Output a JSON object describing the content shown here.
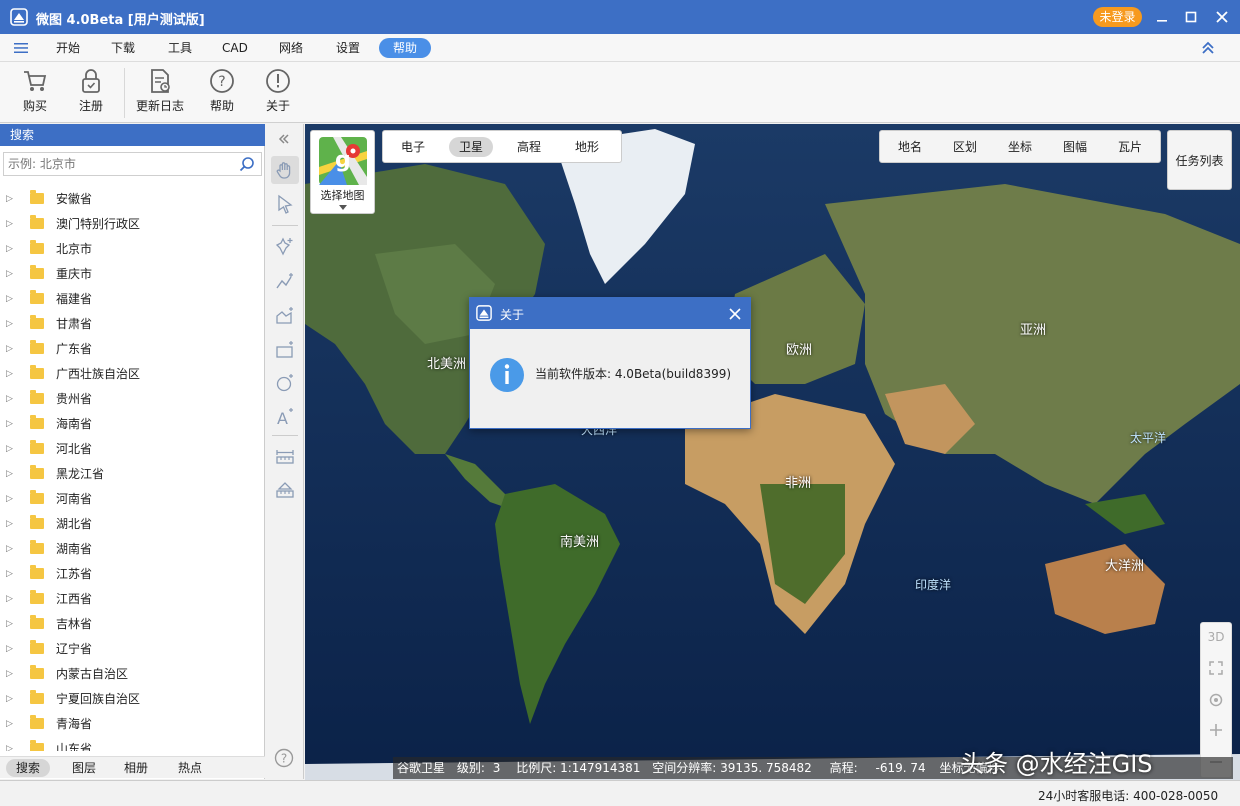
{
  "window": {
    "title": "微图 4.0Beta [用户测试版]",
    "login_label": "未登录"
  },
  "menu": {
    "items": [
      "开始",
      "下载",
      "工具",
      "CAD",
      "网络",
      "设置",
      "帮助"
    ],
    "active": "帮助"
  },
  "ribbon": {
    "buttons": [
      "购买",
      "注册",
      "更新日志",
      "帮助",
      "关于"
    ]
  },
  "left_panel": {
    "header": "搜索",
    "search_placeholder": "示例: 北京市",
    "provinces": [
      "安徽省",
      "澳门特别行政区",
      "北京市",
      "重庆市",
      "福建省",
      "甘肃省",
      "广东省",
      "广西壮族自治区",
      "贵州省",
      "海南省",
      "河北省",
      "黑龙江省",
      "河南省",
      "湖北省",
      "湖南省",
      "江苏省",
      "江西省",
      "吉林省",
      "辽宁省",
      "内蒙古自治区",
      "宁夏回族自治区",
      "青海省",
      "山东省"
    ],
    "tabs": [
      "搜索",
      "图层",
      "相册",
      "热点"
    ],
    "active_tab": "搜索"
  },
  "map": {
    "select_map_label": "选择地图",
    "type_tabs": [
      "电子",
      "卫星",
      "高程",
      "地形"
    ],
    "active_type": "卫星",
    "right_tabs": [
      "地名",
      "区划",
      "坐标",
      "图幅",
      "瓦片"
    ],
    "task_list": "任务列表",
    "labels": {
      "north_america": "北美洲",
      "europe": "欧洲",
      "asia": "亚洲",
      "africa": "非洲",
      "south_america": "南美洲",
      "oceania": "大洋洲",
      "pacific": "太平洋",
      "indian_ocean": "印度洋",
      "atlantic_partial": "大西洋"
    },
    "side_controls": {
      "three_d": "3D"
    },
    "status": {
      "source": "谷歌卫星",
      "level_label": "级别:",
      "level": "3",
      "scale_label": "比例尺:",
      "scale": "1:147914381",
      "resolution_label": "空间分辨率:",
      "resolution": "39135. 758482",
      "elevation_label": "高程:",
      "elevation": "-619. 74",
      "coord_label": "坐标无偏移"
    }
  },
  "dialog": {
    "title": "关于",
    "message": "当前软件版本: 4.0Beta(build8399)"
  },
  "watermark": "头条 @水经注GIS",
  "footer": {
    "hotline": "24小时客服电话: 400-028-0050"
  },
  "colors": {
    "title_bar": "#3d6fc5",
    "accent": "#4a8fe7",
    "login_badge": "#f79a1e",
    "folder": "#f5c642"
  }
}
